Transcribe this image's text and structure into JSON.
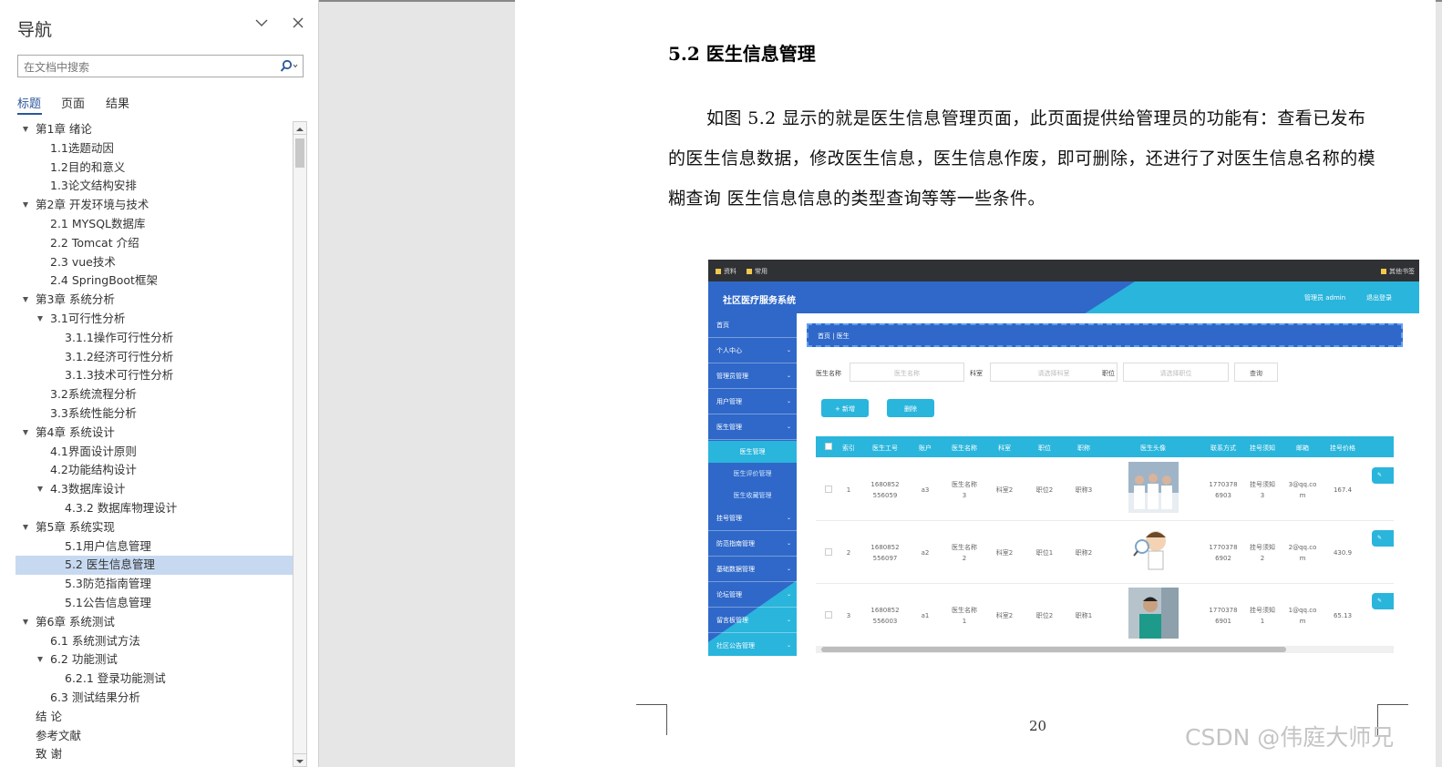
{
  "nav": {
    "title": "导航",
    "search_placeholder": "在文档中搜索",
    "tabs": [
      "标题",
      "页面",
      "结果"
    ],
    "items": [
      {
        "label": "第1章 绪论",
        "level": 1,
        "expanded": true
      },
      {
        "label": "1.1选题动因",
        "level": 2
      },
      {
        "label": "1.2目的和意义",
        "level": 2
      },
      {
        "label": "1.3论文结构安排",
        "level": 2
      },
      {
        "label": "第2章 开发环境与技术",
        "level": 1,
        "expanded": true
      },
      {
        "label": "2.1 MYSQL数据库",
        "level": 2
      },
      {
        "label": "2.2 Tomcat 介绍",
        "level": 2
      },
      {
        "label": "2.3 vue技术",
        "level": 2
      },
      {
        "label": "2.4 SpringBoot框架",
        "level": 2
      },
      {
        "label": "第3章 系统分析",
        "level": 1,
        "expanded": true
      },
      {
        "label": "3.1可行性分析",
        "level": 2,
        "expanded": true
      },
      {
        "label": "3.1.1操作可行性分析",
        "level": 3
      },
      {
        "label": "3.1.2经济可行性分析",
        "level": 3
      },
      {
        "label": "3.1.3技术可行性分析",
        "level": 3
      },
      {
        "label": "3.2系统流程分析",
        "level": 2
      },
      {
        "label": "3.3系统性能分析",
        "level": 2
      },
      {
        "label": "第4章 系统设计",
        "level": 1,
        "expanded": true
      },
      {
        "label": "4.1界面设计原则",
        "level": 2
      },
      {
        "label": "4.2功能结构设计",
        "level": 2
      },
      {
        "label": "4.3数据库设计",
        "level": 2,
        "expanded": true
      },
      {
        "label": "4.3.2 数据库物理设计",
        "level": 3
      },
      {
        "label": "第5章 系统实现",
        "level": 1,
        "expanded": true
      },
      {
        "label": "5.1用户信息管理",
        "level": 3
      },
      {
        "label": "5.2 医生信息管理",
        "level": 3,
        "selected": true
      },
      {
        "label": "5.3防范指南管理",
        "level": 3
      },
      {
        "label": "5.1公告信息管理",
        "level": 3
      },
      {
        "label": "第6章 系统测试",
        "level": 1,
        "expanded": true
      },
      {
        "label": "6.1 系统测试方法",
        "level": 2
      },
      {
        "label": "6.2 功能测试",
        "level": 2,
        "expanded": true
      },
      {
        "label": "6.2.1 登录功能测试",
        "level": 3
      },
      {
        "label": "6.3 测试结果分析",
        "level": 2
      },
      {
        "label": "结  论",
        "level": 1
      },
      {
        "label": "参考文献",
        "level": 1
      },
      {
        "label": "致  谢",
        "level": 1
      }
    ]
  },
  "document": {
    "heading": "5.2  医生信息管理",
    "paragraph": "如图 5.2 显示的就是医生信息管理页面，此页面提供给管理员的功能有：查看已发布的医生信息数据，修改医生信息，医生信息作废，即可删除，还进行了对医生信息名称的模糊查询  医生信息信息的类型查询等等一些条件。",
    "page_number": "20",
    "watermark": "CSDN @伟庭大师兄"
  },
  "screenshot": {
    "bookmarks": [
      "资料",
      "常用"
    ],
    "bookmark_right": "其他书签",
    "app_title": "社区医疗服务系统",
    "user_label": "管理员 admin",
    "logout_label": "退出登录",
    "menu": [
      {
        "label": "首页",
        "chevron": false
      },
      {
        "label": "个人中心",
        "chevron": true
      },
      {
        "label": "管理员管理",
        "chevron": true
      },
      {
        "label": "用户管理",
        "chevron": true
      },
      {
        "label": "医生管理",
        "chevron": true
      }
    ],
    "submenu": [
      {
        "label": "医生管理",
        "active": true
      },
      {
        "label": "医生评价管理",
        "active": false
      },
      {
        "label": "医生收藏管理",
        "active": false
      }
    ],
    "menu_after": [
      "挂号管理",
      "防范指南管理",
      "基础数据管理",
      "论坛管理",
      "留言板管理",
      "社区公告管理"
    ],
    "breadcrumb": "首页  |  医生",
    "search": {
      "name_label": "医生名称",
      "name_placeholder": "医生名称",
      "dept_label": "科室",
      "dept_placeholder": "请选择科室",
      "position_label": "职位",
      "position_placeholder": "请选择职位",
      "query_button": "查询"
    },
    "add_button": "+ 新增",
    "delete_button": "删除",
    "columns": [
      "索引",
      "医生工号",
      "账户",
      "医生名称",
      "科室",
      "职位",
      "职称",
      "医生头像",
      "联系方式",
      "挂号须知",
      "邮箱",
      "挂号价格"
    ],
    "rows": [
      {
        "index": "1",
        "code": "1680852\n556059",
        "account": "a3",
        "name": "医生名称\n3",
        "dept": "科室2",
        "position": "职位2",
        "title": "职称3",
        "phone": "1770378\n6903",
        "notice": "挂号须知\n3",
        "email": "3@qq.co\nm",
        "price": "167.4"
      },
      {
        "index": "2",
        "code": "1680852\n556097",
        "account": "a2",
        "name": "医生名称\n2",
        "dept": "科室2",
        "position": "职位1",
        "title": "职称2",
        "phone": "1770378\n6902",
        "notice": "挂号须知\n2",
        "email": "2@qq.co\nm",
        "price": "430.9"
      },
      {
        "index": "3",
        "code": "1680852\n556003",
        "account": "a1",
        "name": "医生名称\n1",
        "dept": "科室2",
        "position": "职位2",
        "title": "职称1",
        "phone": "1770378\n6901",
        "notice": "挂号须知\n1",
        "email": "1@qq.co\nm",
        "price": "65.13"
      }
    ]
  },
  "colors": {
    "nav_accent": "#2b579a",
    "selection": "#c7d9f1",
    "app_blue": "#2f68c8",
    "app_cyan": "#2ab5dc"
  }
}
